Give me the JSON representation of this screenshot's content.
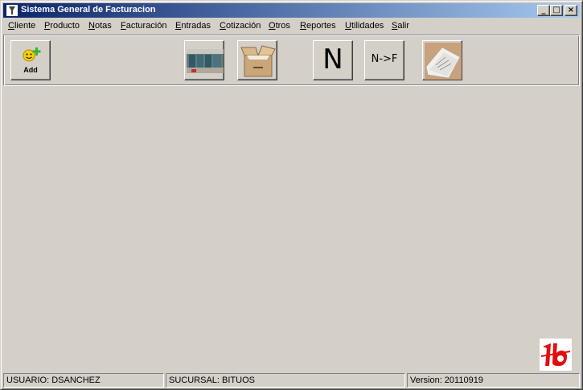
{
  "window": {
    "title": "Sistema General de Facturacion"
  },
  "titlebar_buttons": {
    "minimize": "_",
    "maximize": "□",
    "close": "×"
  },
  "menu": {
    "items": [
      {
        "label": "Cliente"
      },
      {
        "label": "Producto"
      },
      {
        "label": "Notas"
      },
      {
        "label": "Facturación"
      },
      {
        "label": "Entradas"
      },
      {
        "label": "Cotización"
      },
      {
        "label": "Otros"
      },
      {
        "label": "Reportes"
      },
      {
        "label": "Utilidades"
      },
      {
        "label": "Salir"
      }
    ]
  },
  "toolbar": {
    "add_label": "Add",
    "n_label": "N",
    "nf_label": "N->F",
    "icons": [
      "smiley-add-icon",
      "warehouse-icon",
      "box-icon",
      "n-icon",
      "n-to-f-icon",
      "document-icon"
    ]
  },
  "status": {
    "user": "USUARIO: DSANCHEZ",
    "branch": "SUCURSAL: BITUOS",
    "version": "Version: 20110919"
  },
  "colors": {
    "titlebar_start": "#0a246a",
    "titlebar_end": "#a6caf0",
    "window_bg": "#d4d0c8",
    "logo_red": "#e01010"
  }
}
